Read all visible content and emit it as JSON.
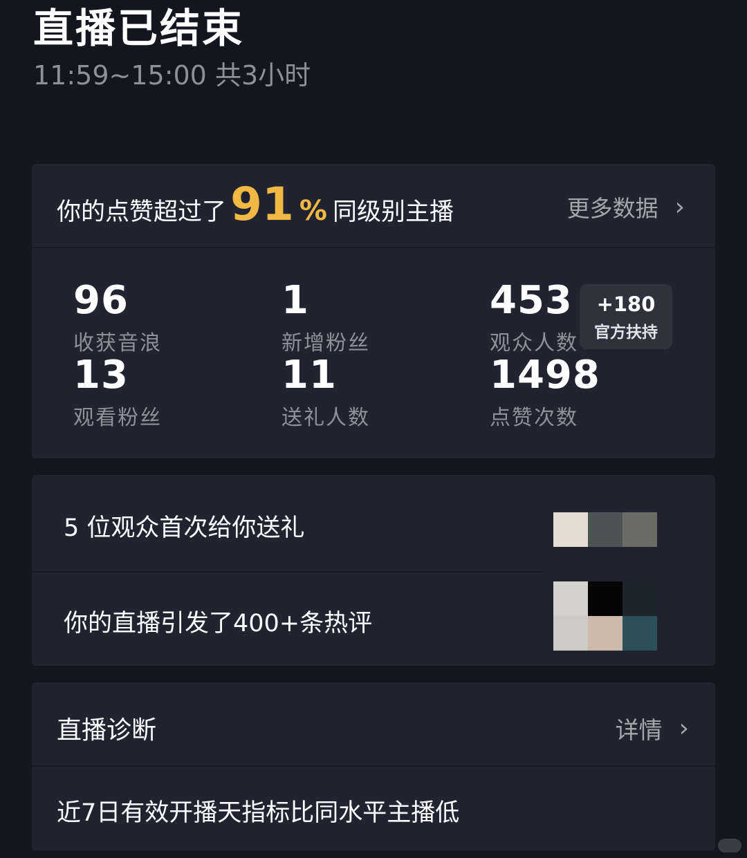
{
  "header": {
    "title": "直播已结束",
    "time_range": "11:59~15:00 共3小时"
  },
  "summary": {
    "banner_prefix": "你的点赞超过了",
    "percent": "91",
    "percent_sign": "%",
    "banner_suffix": "同级别主播",
    "more_data_label": "更多数据",
    "stats": [
      {
        "value": "96",
        "label": "收获音浪"
      },
      {
        "value": "1",
        "label": "新增粉丝"
      },
      {
        "value": "453",
        "label": "观众人数"
      },
      {
        "value": "13",
        "label": "观看粉丝"
      },
      {
        "value": "11",
        "label": "送礼人数"
      },
      {
        "value": "1498",
        "label": "点赞次数"
      }
    ],
    "boost": {
      "value": "+180",
      "label": "官方扶持"
    }
  },
  "highlights": {
    "gift_row": "5 位观众首次给你送礼",
    "comment_row": "你的直播引发了400+条热评",
    "gift_avatar_colors": [
      "#e6ddd2",
      "#4b5453",
      "#6b6c68"
    ],
    "comment_avatar_colors": [
      "#d2d1cd",
      "#050506",
      "#1d262b",
      "#cdcac4",
      "#cdb8ac",
      "#2e4f59"
    ]
  },
  "diagnosis": {
    "title": "直播诊断",
    "detail_label": "详情",
    "message": "近7日有效开播天指标比同水平主播低"
  },
  "icons": {
    "chevron": "chevron-right-icon"
  }
}
